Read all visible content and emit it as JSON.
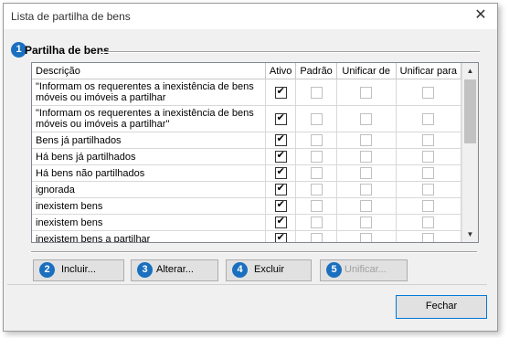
{
  "window": {
    "title": "Lista de partilha de bens",
    "close_glyph": "✕"
  },
  "group": {
    "badge": "1",
    "title": "Partilha de bens"
  },
  "table": {
    "columns": [
      "Descrição",
      "Ativo",
      "Padrão",
      "Unificar de",
      "Unificar para"
    ],
    "rows": [
      {
        "desc": "\"Informam os requerentes a inexistência de bens móveis ou imóveis a partilhar",
        "ativo": true
      },
      {
        "desc": "\"Informam os requerentes a inexistência de bens móveis ou imóveis a partilhar\"",
        "ativo": true
      },
      {
        "desc": "Bens já partilhados",
        "ativo": true
      },
      {
        "desc": "Há bens já partilhados",
        "ativo": true
      },
      {
        "desc": "Há bens não partilhados",
        "ativo": true
      },
      {
        "desc": "ignorada",
        "ativo": true
      },
      {
        "desc": "inexistem bens",
        "ativo": true
      },
      {
        "desc": "inexistem bens",
        "ativo": true
      },
      {
        "desc": "inexistem bens a partilhar",
        "ativo": true
      }
    ]
  },
  "buttons": {
    "incluir": {
      "badge": "2",
      "label": "Incluir..."
    },
    "alterar": {
      "badge": "3",
      "label": "Alterar..."
    },
    "excluir": {
      "badge": "4",
      "label": "Excluir"
    },
    "unificar": {
      "badge": "5",
      "label": "Unificar..."
    },
    "fechar": {
      "label": "Fechar"
    }
  },
  "colors": {
    "badge": "#1a6fbf",
    "focus_border": "#0078d7"
  }
}
